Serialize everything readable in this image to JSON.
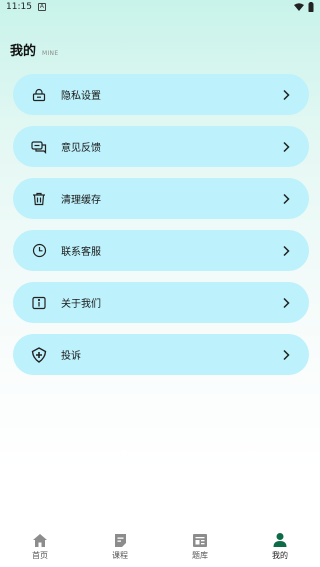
{
  "status_bar": {
    "time": "11:15",
    "notification_badge": "A"
  },
  "header": {
    "title": "我的",
    "subtitle": "MINE"
  },
  "menu": {
    "items": [
      {
        "label": "隐私设置",
        "icon": "lock-icon"
      },
      {
        "label": "意见反馈",
        "icon": "feedback-icon"
      },
      {
        "label": "清理缓存",
        "icon": "trash-icon"
      },
      {
        "label": "联系客服",
        "icon": "clock-icon"
      },
      {
        "label": "关于我们",
        "icon": "info-icon"
      },
      {
        "label": "投诉",
        "icon": "shield-icon"
      }
    ]
  },
  "tabbar": {
    "tabs": [
      {
        "label": "首页",
        "icon": "home-icon"
      },
      {
        "label": "课程",
        "icon": "course-icon"
      },
      {
        "label": "题库",
        "icon": "question-bank-icon"
      },
      {
        "label": "我的",
        "icon": "person-icon"
      }
    ],
    "active": "我的"
  },
  "colors": {
    "menu_item_bg": "#bdf1fb",
    "active_tab": "#0e6b47",
    "inactive_tab": "#8c8c8c"
  }
}
